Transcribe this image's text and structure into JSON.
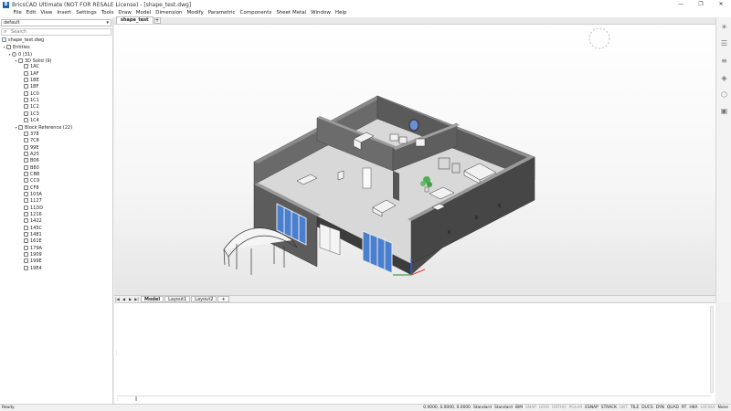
{
  "titlebar": {
    "app_icon": "B",
    "title": "BricsCAD Ultimate (NOT FOR RESALE License) - [shape_test.dwg]",
    "minimize": "—",
    "maximize": "❐",
    "close": "✕"
  },
  "menu": [
    "File",
    "Edit",
    "View",
    "Insert",
    "Settings",
    "Tools",
    "Draw",
    "Model",
    "Dimension",
    "Modify",
    "Parametric",
    "Components",
    "Sheet Metal",
    "Window",
    "Help"
  ],
  "left_panel": {
    "workspace_value": "default",
    "search_placeholder": "Search",
    "tree": {
      "file": "shape_test.dwg",
      "entities": "Entities",
      "layer": "0 (31)",
      "solids_group": "3D Solid (9)",
      "solids": [
        "1AC",
        "1AF",
        "1BE",
        "1BF",
        "1C0",
        "1C1",
        "1C2",
        "1C3",
        "1C4"
      ],
      "blocks_group": "Block Reference (22)",
      "blocks": [
        "378",
        "7C8",
        "99E",
        "A25",
        "B06",
        "B80",
        "CBB",
        "CC9",
        "CF8",
        "103A",
        "1127",
        "11DD",
        "1216",
        "1422",
        "145C",
        "1481",
        "161E",
        "179A",
        "1909",
        "199E",
        "19E4"
      ]
    }
  },
  "doc_tabs": {
    "active": "shape_test",
    "add": "+"
  },
  "layout_tabs": {
    "nav": [
      "|◀",
      "◀",
      "▶",
      "▶|"
    ],
    "tabs": [
      "Model",
      "Layout1",
      "Layout2"
    ],
    "add": "+"
  },
  "command": {
    "prompt_mark": "»",
    "input_value": ":",
    "cursor": "I"
  },
  "right_tools": {
    "icons": [
      "lightbulb-icon",
      "properties-icon",
      "sliders-icon",
      "layers-icon",
      "cube-icon",
      "bim-icon"
    ]
  },
  "statusbar": {
    "ready": "Ready",
    "coords": "0.0000, 0.0000, 0.0000",
    "items": [
      {
        "label": "Standard",
        "on": true
      },
      {
        "label": "Standard",
        "on": true
      },
      {
        "label": "BIM",
        "on": true
      },
      {
        "label": "SNAP",
        "on": false
      },
      {
        "label": "GRID",
        "on": false
      },
      {
        "label": "ORTHO",
        "on": false
      },
      {
        "label": "POLAR",
        "on": false
      },
      {
        "label": "ESNAP",
        "on": true
      },
      {
        "label": "STRACK",
        "on": true
      },
      {
        "label": "LWT",
        "on": false
      },
      {
        "label": "TILE",
        "on": true
      },
      {
        "label": "DUCS",
        "on": true
      },
      {
        "label": "DYN",
        "on": true
      },
      {
        "label": "QUAD",
        "on": true
      },
      {
        "label": "RT",
        "on": true
      },
      {
        "label": "HKA",
        "on": true
      },
      {
        "label": "LOCKUI",
        "on": false
      },
      {
        "label": "None",
        "on": true
      }
    ]
  },
  "colors": {
    "wall": "#5c5c5c",
    "wall_dark": "#464646",
    "floor": "#dcdcdc",
    "window": "#4a7fcf",
    "accent": "#1f5fb5"
  }
}
